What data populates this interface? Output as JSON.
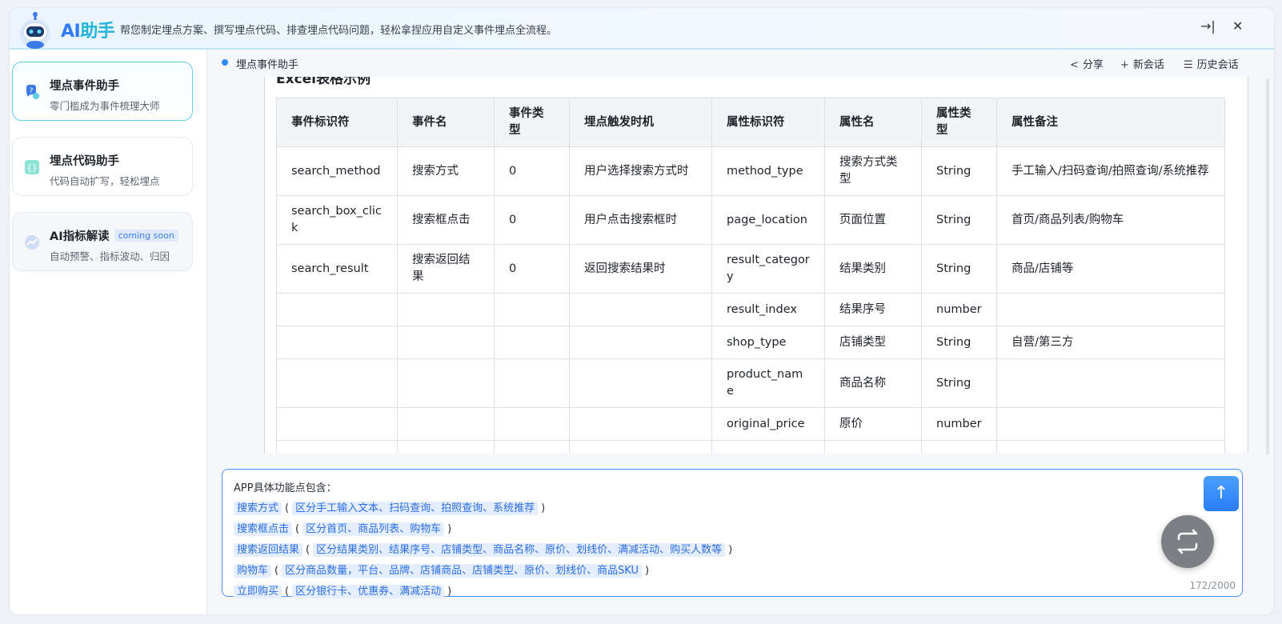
{
  "header": {
    "brand_a": "AI",
    "brand_b": "助手",
    "subtitle": "帮您制定埋点方案、撰写埋点代码、排查埋点代码问题，轻松拿捏应用自定义事件埋点全流程。",
    "collapse_glyph": "→|",
    "close_glyph": "✕"
  },
  "sidebar": {
    "items": [
      {
        "title": "埋点事件助手",
        "desc": "零门槛成为事件梳理大师",
        "icon": "tracking-event-icon"
      },
      {
        "title": "埋点代码助手",
        "desc": "代码自动扩写，轻松埋点",
        "icon": "code-braces-icon"
      },
      {
        "title": "AI指标解读",
        "badge": "coming soon",
        "desc": "自动预警、指标波动、归因",
        "icon": "trend-chart-icon"
      }
    ]
  },
  "topbar": {
    "crumb": "埋点事件助手",
    "share": "分享",
    "new_chat": "新会话",
    "history": "历史会话"
  },
  "content": {
    "excel_title": "Excel表格示例",
    "table": {
      "headers": [
        "事件标识符",
        "事件名",
        "事件类型",
        "埋点触发时机",
        "属性标识符",
        "属性名",
        "属性类型",
        "属性备注"
      ],
      "rows": [
        [
          "search_method",
          "搜索方式",
          "0",
          "用户选择搜索方式时",
          "method_type",
          "搜索方式类型",
          "String",
          "手工输入/扫码查询/拍照查询/系统推荐"
        ],
        [
          "search_box_click",
          "搜索框点击",
          "0",
          "用户点击搜索框时",
          "page_location",
          "页面位置",
          "String",
          "首页/商品列表/购物车"
        ],
        [
          "search_result",
          "搜索返回结果",
          "0",
          "返回搜索结果时",
          "result_category",
          "结果类别",
          "String",
          "商品/店铺等"
        ],
        [
          "",
          "",
          "",
          "",
          "result_index",
          "结果序号",
          "number",
          ""
        ],
        [
          "",
          "",
          "",
          "",
          "shop_type",
          "店铺类型",
          "String",
          "自营/第三方"
        ],
        [
          "",
          "",
          "",
          "",
          "product_name",
          "商品名称",
          "String",
          ""
        ],
        [
          "",
          "",
          "",
          "",
          "original_price",
          "原价",
          "number",
          ""
        ],
        [
          "",
          "",
          "",
          "",
          "",
          "",
          "",
          ""
        ]
      ]
    }
  },
  "input": {
    "title": "APP具体功能点包含：",
    "lines": [
      {
        "tag": "搜索方式",
        "detail": "区分手工输入文本、扫码查询、拍照查询、系统推荐"
      },
      {
        "tag": "搜索框点击",
        "detail": "区分首页、商品列表、购物车"
      },
      {
        "tag": "搜索返回结果",
        "detail": "区分结果类别、结果序号、店铺类型、商品名称、原价、划线价、满减活动、购买人数等"
      },
      {
        "tag": "购物车",
        "detail": "区分商品数量，平台、品牌、店铺商品、店铺类型、原价、划线价、商品SKU"
      },
      {
        "tag": "立即购买",
        "detail": "区分银行卡、优惠券、满减活动"
      }
    ],
    "paren_open": "(",
    "paren_close": ")",
    "char_count": "172/2000",
    "send_glyph": "↑"
  },
  "colors": {
    "accent": "#2f7cf6",
    "active_border": "#5fcfe6",
    "tag_bg": "#e4eeff",
    "tag_text": "#2c6ee6"
  }
}
